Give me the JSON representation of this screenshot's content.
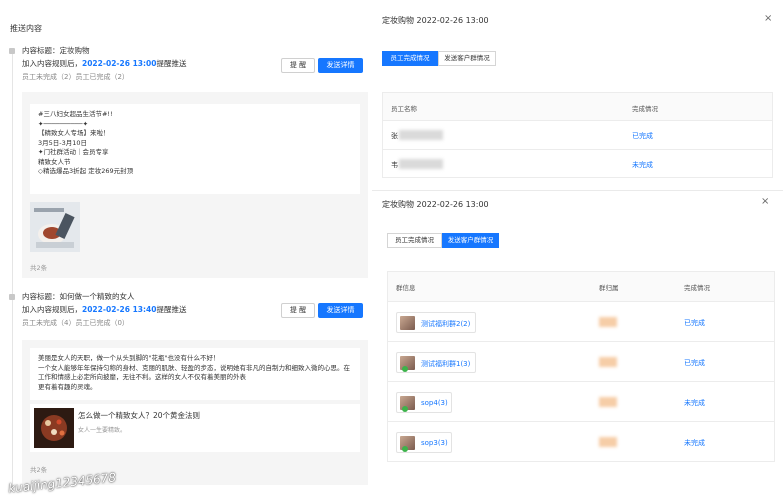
{
  "left": {
    "title": "推送内容",
    "items": [
      {
        "title": "内容标题：定妆购物",
        "line2_prefix": "加入内容规则后，",
        "time": "2022-02-26 13:00",
        "line2_suffix": "提醒推送",
        "status": "员工未完成（2）员工已完成（2）",
        "remind_label": "提 醒",
        "detail_label": "发送详情",
        "message": "#三八妇女超品生活节#!!\n✦──────────✦\n【精致女人专场】来啦！\n3月5日-3月10日\n✦门社群活动｜会员专享\n精致女人节\n◇精选爆品3折起 定妆269元封顶",
        "count": "共2条"
      },
      {
        "title": "内容标题：如何做一个精致的女人",
        "line2_prefix": "加入内容规则后，",
        "time": "2022-02-26 13:40",
        "line2_suffix": "提醒推送",
        "status": "员工未完成（4）员工已完成（0）",
        "remind_label": "提 醒",
        "detail_label": "发送详情",
        "message": "美丽是女人的天职，做一个从头到脚的\"花瓶\"也没有什么不好！\n一个女人能够年年保持匀称的身材、克丽的肌肤、轻盈的步态，说明她有非凡的自制力和细致入微的心思。在工作和情感上必定所向披靡，无往不利。这样的女人不仅有着美丽的外表\n更有着有趣的灵魂。",
        "link_title": "怎么做一个精致女人？20个黄金法则",
        "link_sub": "女人一生要精致。",
        "count": "共2条"
      }
    ],
    "watermark": "kuaijing12345678"
  },
  "panel1": {
    "title": "定妆购物 2022-02-26 13:00",
    "close": "×",
    "tabs": [
      "员工完成情况",
      "发送客户群情况"
    ],
    "columns": [
      "员工名称",
      "完成情况"
    ],
    "rows": [
      {
        "name": "张",
        "status": "已完成"
      },
      {
        "name": "韦",
        "status": "未完成"
      }
    ]
  },
  "panel2": {
    "title": "定妆购物 2022-02-26 13:00",
    "close": "×",
    "tabs": [
      "员工完成情况",
      "发送客户群情况"
    ],
    "columns": [
      "群信息",
      "群归属",
      "完成情况"
    ],
    "rows": [
      {
        "group": "测试福利群2(2)",
        "status": "已完成"
      },
      {
        "group": "测试福利群1(3)",
        "status": "已完成"
      },
      {
        "group": "sop4(3)",
        "status": "未完成"
      },
      {
        "group": "sop3(3)",
        "status": "未完成"
      }
    ]
  },
  "colors": {
    "accent": "#1677ff",
    "tab_border": "#d5d5d5"
  }
}
